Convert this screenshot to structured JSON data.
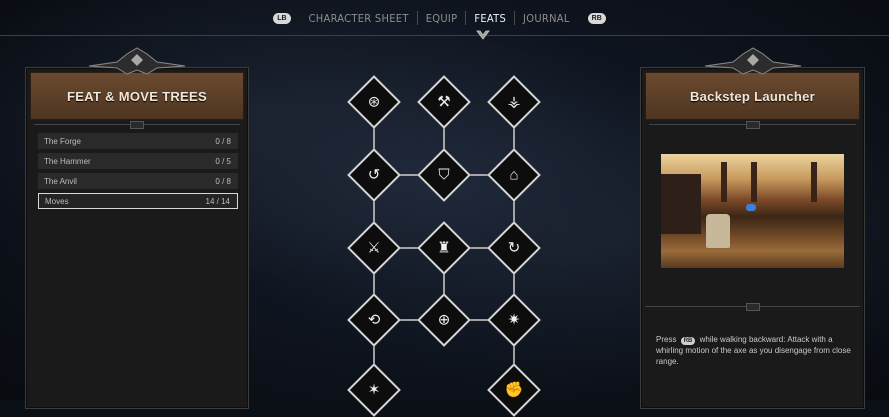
{
  "nav": {
    "left_button": "LB",
    "right_button": "RB",
    "tabs": [
      {
        "label": "CHARACTER SHEET",
        "active": false
      },
      {
        "label": "EQUIP",
        "active": false
      },
      {
        "label": "FEATS",
        "active": true
      },
      {
        "label": "JOURNAL",
        "active": false
      }
    ]
  },
  "left_panel": {
    "title": "FEAT & MOVE TREES",
    "items": [
      {
        "name": "The Forge",
        "progress": "0 / 8",
        "selected": false
      },
      {
        "name": "The Hammer",
        "progress": "0 / 5",
        "selected": false
      },
      {
        "name": "The Anvil",
        "progress": "0 / 8",
        "selected": false
      },
      {
        "name": "Moves",
        "progress": "14 / 14",
        "selected": true
      }
    ]
  },
  "right_panel": {
    "title": "Backstep Launcher",
    "description_prefix": "Press",
    "description_button": "RB",
    "description_text": "while walking backward: Attack with a whirling motion of the axe as you disengage from close range."
  },
  "tree": {
    "nodes": [
      {
        "icon": "axe-spin-icon",
        "glyph": "⊛"
      },
      {
        "icon": "axe-slash-icon",
        "glyph": "⚒"
      },
      {
        "icon": "axe-ground-icon",
        "glyph": "⚶"
      },
      {
        "icon": "axe-arc-icon",
        "glyph": "↺"
      },
      {
        "icon": "shield-axe-icon",
        "glyph": "⛉"
      },
      {
        "icon": "boot-kick-icon",
        "glyph": "⌂"
      },
      {
        "icon": "axe-throw-icon",
        "glyph": "⚔"
      },
      {
        "icon": "tankard-icon",
        "glyph": "♜"
      },
      {
        "icon": "axe-swing-icon",
        "glyph": "↻"
      },
      {
        "icon": "axe-backswing-icon",
        "glyph": "⟲"
      },
      {
        "icon": "axe-circle-icon",
        "glyph": "⊕"
      },
      {
        "icon": "axe-burst-icon",
        "glyph": "✷"
      },
      {
        "icon": "ground-burst-icon",
        "glyph": "✶"
      },
      {
        "icon": "fist-icon",
        "glyph": "✊"
      }
    ]
  }
}
